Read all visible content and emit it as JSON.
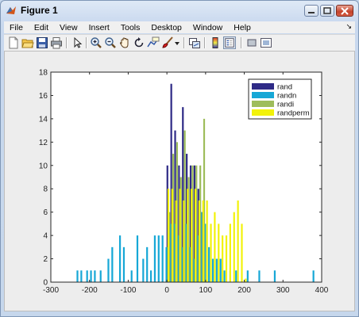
{
  "window": {
    "title": "Figure 1"
  },
  "menu": [
    "File",
    "Edit",
    "View",
    "Insert",
    "Tools",
    "Desktop",
    "Window",
    "Help"
  ],
  "menu_overflow": "↘",
  "toolbar": {
    "icons": [
      "new-figure-icon",
      "open-file-icon",
      "save-icon",
      "print-icon",
      "pointer-icon",
      "zoom-in-icon",
      "zoom-out-icon",
      "pan-hand-icon",
      "rotate-3d-icon",
      "data-cursor-icon",
      "brush-icon",
      "link-plot-icon",
      "insert-colorbar-icon",
      "insert-legend-icon",
      "hide-plot-tools-icon",
      "show-plot-tools-icon"
    ]
  },
  "colors": {
    "rand": "#2e2a86",
    "randn": "#16a7d6",
    "randi": "#9ebd5b",
    "randperm": "#f2f20a"
  },
  "chart_data": {
    "type": "bar",
    "title": "",
    "xlabel": "",
    "ylabel": "",
    "xlim": [
      -300,
      400
    ],
    "ylim": [
      0,
      18
    ],
    "xticks": [
      -300,
      -200,
      -100,
      0,
      100,
      200,
      300,
      400
    ],
    "yticks": [
      0,
      2,
      4,
      6,
      8,
      10,
      12,
      14,
      16,
      18
    ],
    "grid": false,
    "legend_position": "top-right",
    "series": [
      {
        "name": "rand",
        "x": [
          5,
          15,
          25,
          35,
          45,
          55,
          65,
          75,
          85,
          95
        ],
        "values": [
          10,
          17,
          13,
          10,
          15,
          11,
          10,
          10,
          8,
          6
        ]
      },
      {
        "name": "randn",
        "x": [
          -230,
          -220,
          -205,
          -195,
          -185,
          -170,
          -150,
          -140,
          -120,
          -110,
          -90,
          -75,
          -60,
          -50,
          -40,
          -30,
          -20,
          -10,
          0,
          10,
          20,
          30,
          40,
          50,
          60,
          70,
          80,
          90,
          100,
          110,
          120,
          130,
          140,
          150,
          165,
          180,
          210,
          240,
          280,
          380
        ],
        "values": [
          1,
          1,
          1,
          1,
          1,
          1,
          2,
          3,
          4,
          3,
          1,
          4,
          2,
          3,
          1,
          4,
          4,
          4,
          3,
          5,
          5,
          4,
          3,
          5,
          3,
          2,
          4,
          6,
          5,
          3,
          2,
          2,
          2,
          1,
          1,
          1,
          1,
          1,
          1,
          1
        ]
      },
      {
        "name": "randi",
        "x": [
          5,
          15,
          25,
          35,
          45,
          55,
          65,
          75,
          85,
          95
        ],
        "values": [
          6,
          11,
          12,
          9,
          13,
          9,
          10,
          10,
          10,
          14
        ]
      },
      {
        "name": "randperm",
        "x": [
          0,
          10,
          20,
          30,
          40,
          50,
          60,
          70,
          80,
          90,
          100,
          110,
          120,
          130,
          140,
          150,
          160,
          170,
          180,
          190,
          200
        ],
        "values": [
          8,
          8,
          7,
          8,
          7,
          8,
          8,
          8,
          7,
          7,
          7,
          5,
          6,
          5,
          4,
          4,
          5,
          6,
          7,
          5,
          0.3
        ]
      }
    ]
  }
}
